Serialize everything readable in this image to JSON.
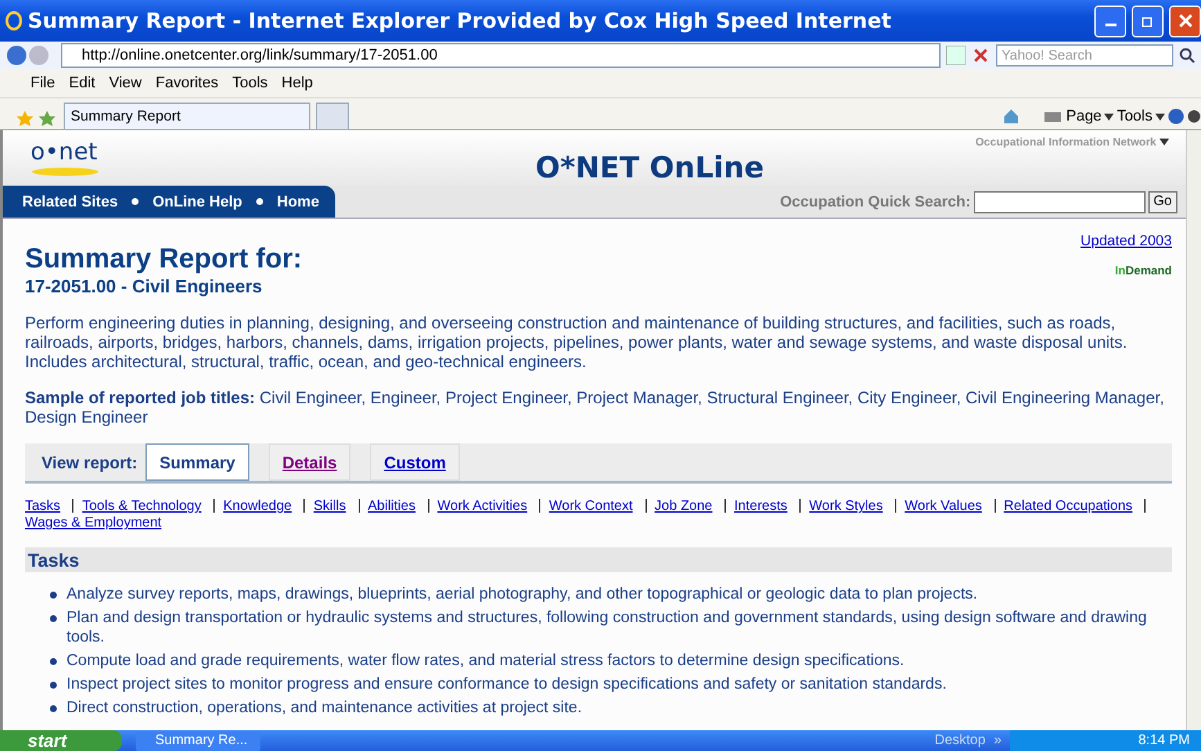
{
  "window": {
    "title": "Summary Report - Internet Explorer Provided by Cox High Speed Internet"
  },
  "address": {
    "url": "http://online.onetcenter.org/link/summary/17-2051.00"
  },
  "search": {
    "placeholder": "Yahoo! Search"
  },
  "menu": [
    "File",
    "Edit",
    "View",
    "Favorites",
    "Tools",
    "Help"
  ],
  "browser_tabs": [
    {
      "label": "Summary Report",
      "selected": true
    }
  ],
  "command_bar": [
    "Page",
    "Tools"
  ],
  "site": {
    "logo": "o•net",
    "title": "O*NET OnLine",
    "network": "Occupational Information Network",
    "nav": [
      "Related Sites",
      "OnLine Help",
      "Home"
    ],
    "quick_search": {
      "label": "Occupation Quick Search:",
      "button": "Go"
    }
  },
  "updated": "Updated 2003",
  "indemand": {
    "prefix": "In",
    "rest": "Demand"
  },
  "heading": "Summary Report for:",
  "occupation": "17-2051.00 - Civil Engineers",
  "description": "Perform engineering duties in planning, designing, and overseeing construction and maintenance of building structures, and facilities, such as roads, railroads, airports, bridges, harbors, channels, dams, irrigation projects, pipelines, power plants, water and sewage systems, and waste disposal units. Includes architectural, structural, traffic, ocean, and geo-technical engineers.",
  "sample": {
    "label": "Sample of reported job titles:",
    "text": "Civil Engineer, Engineer, Project Engineer, Project Manager, Structural Engineer, City Engineer, Civil Engineering Manager, Design Engineer"
  },
  "view_report": {
    "label": "View report:",
    "tabs": [
      {
        "label": "Summary",
        "selected": true,
        "visited": false
      },
      {
        "label": "Details",
        "selected": false,
        "visited": true
      },
      {
        "label": "Custom",
        "selected": false,
        "visited": false
      }
    ]
  },
  "section_links": [
    "Tasks",
    "Tools & Technology",
    "Knowledge",
    "Skills",
    "Abilities",
    "Work Activities",
    "Work Context",
    "Job Zone",
    "Interests",
    "Work Styles",
    "Work Values",
    "Related Occupations",
    "Wages & Employment"
  ],
  "section_title": "Tasks",
  "tasks": [
    "Analyze survey reports, maps, drawings, blueprints, aerial photography, and other topographical or geologic data to plan projects.",
    "Plan and design transportation or hydraulic systems and structures, following construction and government standards, using design software and drawing tools.",
    "Compute load and grade requirements, water flow rates, and material stress factors to determine design specifications.",
    "Inspect project sites to monitor progress and ensure conformance to design specifications and safety or sanitation standards.",
    "Direct construction, operations, and maintenance activities at project site."
  ],
  "taskbar": {
    "start": "start",
    "tasks": [
      {
        "label": "Summary Re...",
        "selected": false
      }
    ],
    "desktop": "Desktop",
    "chevron": "»",
    "time": "8:14 PM"
  }
}
